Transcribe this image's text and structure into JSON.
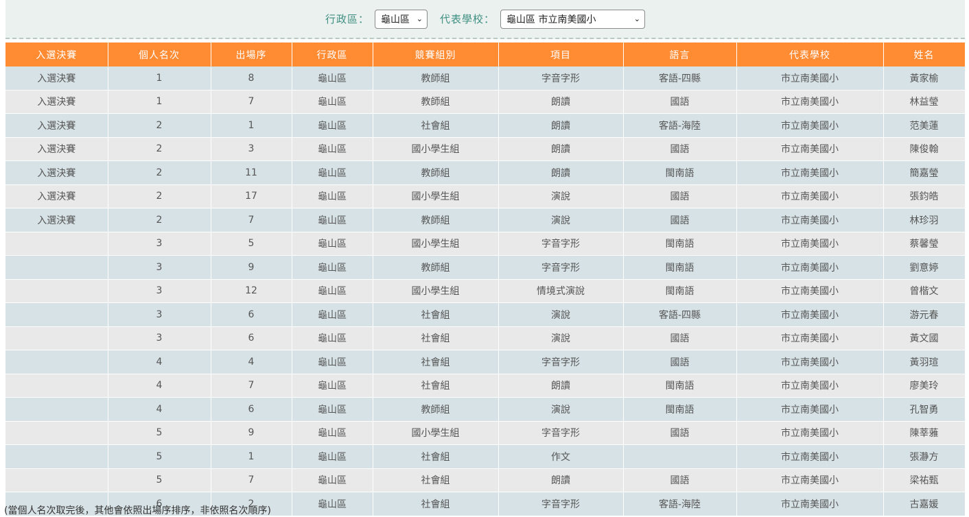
{
  "filters": {
    "district_label": "行政區：",
    "district_value": "龜山區",
    "school_label": "代表學校：",
    "school_value": "龜山區 市立南美國小"
  },
  "table": {
    "headers": [
      "入選決賽",
      "個人名次",
      "出場序",
      "行政區",
      "競賽組別",
      "項目",
      "語言",
      "代表學校",
      "姓名"
    ],
    "rows": [
      [
        "入選決賽",
        "1",
        "8",
        "龜山區",
        "教師組",
        "字音字形",
        "客語-四縣",
        "市立南美國小",
        "黃家榆"
      ],
      [
        "入選決賽",
        "1",
        "7",
        "龜山區",
        "教師組",
        "朗讀",
        "國語",
        "市立南美國小",
        "林益瑩"
      ],
      [
        "入選決賽",
        "2",
        "1",
        "龜山區",
        "社會組",
        "朗讀",
        "客語-海陸",
        "市立南美國小",
        "范美蓮"
      ],
      [
        "入選決賽",
        "2",
        "3",
        "龜山區",
        "國小學生組",
        "朗讀",
        "國語",
        "市立南美國小",
        "陳俊翰"
      ],
      [
        "入選決賽",
        "2",
        "11",
        "龜山區",
        "教師組",
        "朗讀",
        "閩南語",
        "市立南美國小",
        "簡嘉瑩"
      ],
      [
        "入選決賽",
        "2",
        "17",
        "龜山區",
        "國小學生組",
        "演說",
        "國語",
        "市立南美國小",
        "張鈞皓"
      ],
      [
        "入選決賽",
        "2",
        "7",
        "龜山區",
        "教師組",
        "演說",
        "國語",
        "市立南美國小",
        "林珍羽"
      ],
      [
        "",
        "3",
        "5",
        "龜山區",
        "國小學生組",
        "字音字形",
        "閩南語",
        "市立南美國小",
        "蔡馨瑩"
      ],
      [
        "",
        "3",
        "9",
        "龜山區",
        "教師組",
        "字音字形",
        "閩南語",
        "市立南美國小",
        "劉意婷"
      ],
      [
        "",
        "3",
        "12",
        "龜山區",
        "國小學生組",
        "情境式演說",
        "閩南語",
        "市立南美國小",
        "曾楷文"
      ],
      [
        "",
        "3",
        "6",
        "龜山區",
        "社會組",
        "演說",
        "客語-四縣",
        "市立南美國小",
        "游元春"
      ],
      [
        "",
        "3",
        "6",
        "龜山區",
        "社會組",
        "演說",
        "國語",
        "市立南美國小",
        "黃文國"
      ],
      [
        "",
        "4",
        "4",
        "龜山區",
        "社會組",
        "字音字形",
        "國語",
        "市立南美國小",
        "黃羽瑄"
      ],
      [
        "",
        "4",
        "7",
        "龜山區",
        "社會組",
        "朗讀",
        "閩南語",
        "市立南美國小",
        "廖美玲"
      ],
      [
        "",
        "4",
        "6",
        "龜山區",
        "教師組",
        "演說",
        "閩南語",
        "市立南美國小",
        "孔智勇"
      ],
      [
        "",
        "5",
        "9",
        "龜山區",
        "國小學生組",
        "字音字形",
        "國語",
        "市立南美國小",
        "陳莘蕥"
      ],
      [
        "",
        "5",
        "1",
        "龜山區",
        "社會組",
        "作文",
        "",
        "市立南美國小",
        "張瀞方"
      ],
      [
        "",
        "5",
        "7",
        "龜山區",
        "社會組",
        "朗讀",
        "國語",
        "市立南美國小",
        "梁祐甄"
      ],
      [
        "",
        "6",
        "2",
        "龜山區",
        "社會組",
        "字音字形",
        "客語-海陸",
        "市立南美國小",
        "古嘉媛"
      ]
    ]
  },
  "note": "(當個人名次取完後，其他會依照出場序排序，非依照名次順序)",
  "colors": {
    "header_bg": "#ff8b33",
    "row_odd": "#d7e2e6",
    "row_even": "#e9e9e9",
    "label": "#3f8f83"
  }
}
